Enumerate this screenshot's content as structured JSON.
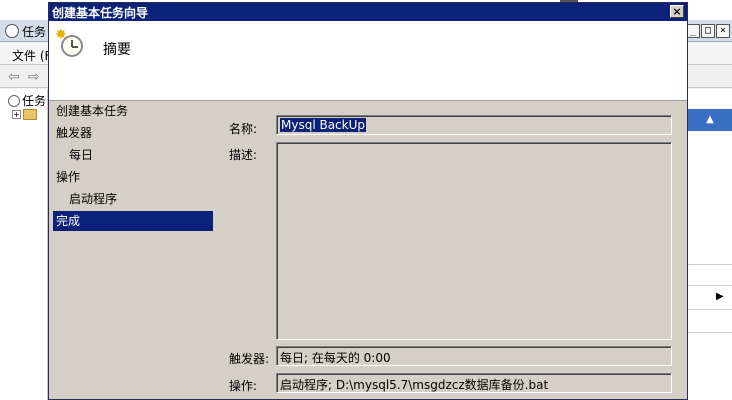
{
  "background_window": {
    "title": "任务",
    "menu_label": "文件 (F",
    "tree_root_label": "任务",
    "window_controls": [
      "_",
      "□",
      "×"
    ]
  },
  "dialog": {
    "title": "创建基本任务向导",
    "close_glyph": "×",
    "heading": "摘要",
    "steps": [
      {
        "label": "创建基本任务",
        "level": "top",
        "active": false
      },
      {
        "label": "触发器",
        "level": "main",
        "active": false
      },
      {
        "label": "每日",
        "level": "sub",
        "active": false
      },
      {
        "label": "操作",
        "level": "main",
        "active": false
      },
      {
        "label": "启动程序",
        "level": "sub",
        "active": false
      },
      {
        "label": "完成",
        "level": "main",
        "active": true
      }
    ],
    "form": {
      "name_label": "名称:",
      "name_value": "Mysql BackUp",
      "description_label": "描述:",
      "description_value": "",
      "trigger_label": "触发器:",
      "trigger_value": "每日; 在每天的 0:00",
      "action_label": "操作:",
      "action_value": "启动程序; D:\\mysql5.7\\msgdzcz数据库备份.bat"
    }
  },
  "colors": {
    "title_bar": "#0b2278",
    "selection": "#0b2278",
    "dialog_face": "#d4d0c8",
    "accent_panel": "#3a6fc4"
  }
}
